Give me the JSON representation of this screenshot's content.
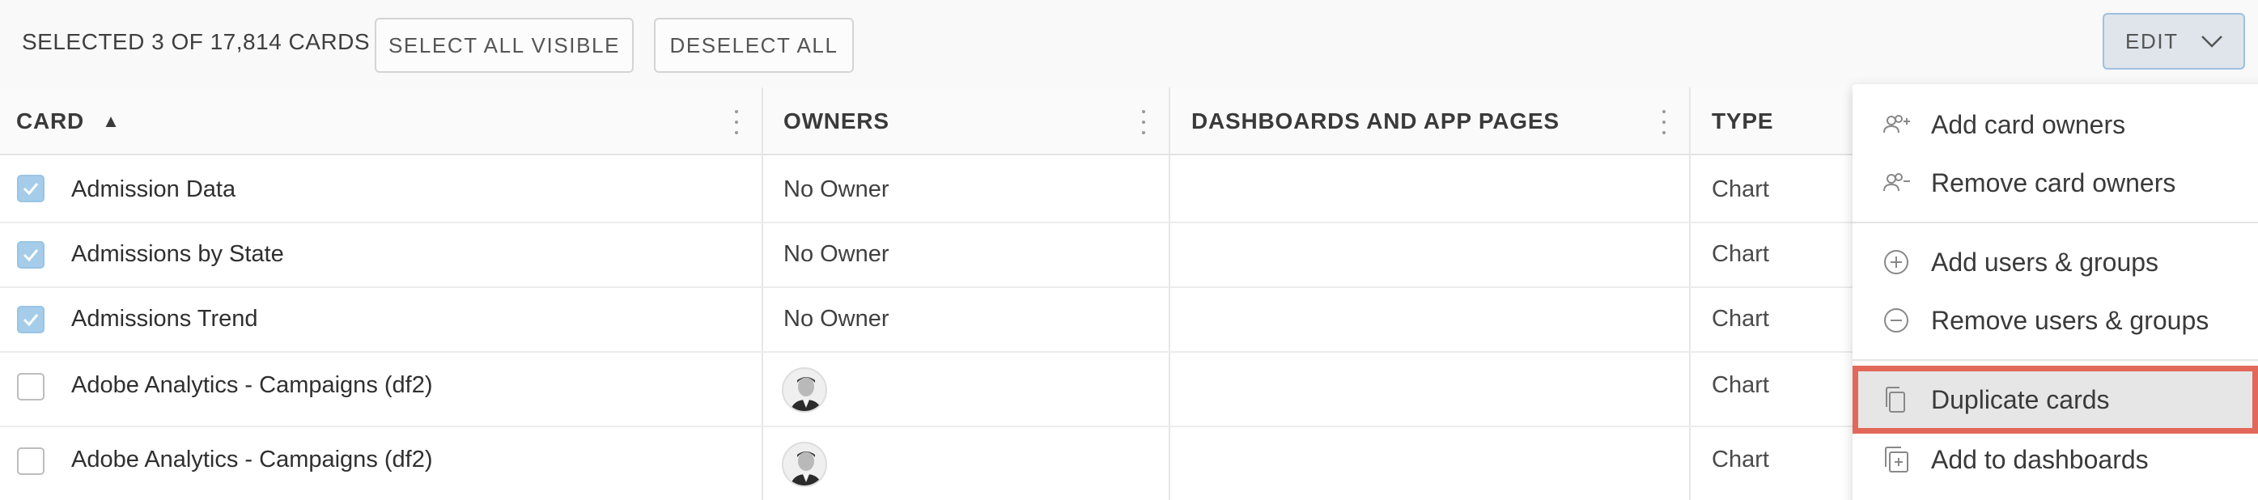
{
  "toolbar": {
    "selected_text": "SELECTED 3 OF 17,814 CARDS",
    "select_all_label": "SELECT ALL VISIBLE",
    "deselect_label": "DESELECT ALL",
    "edit_label": "EDIT"
  },
  "table": {
    "columns": {
      "card": "CARD",
      "sort_indicator": "▲",
      "owners": "OWNERS",
      "dashboards": "DASHBOARDS AND APP PAGES",
      "type": "TYPE"
    },
    "rows": [
      {
        "name": "Admission Data",
        "owner": "No Owner",
        "type": "Chart",
        "checked": true
      },
      {
        "name": "Admissions by State",
        "owner": "No Owner",
        "type": "Chart",
        "checked": true
      },
      {
        "name": "Admissions Trend",
        "owner": "No Owner",
        "type": "Chart",
        "checked": true
      },
      {
        "name": "Adobe Analytics - Campaigns (df2)",
        "owner": "",
        "type": "Chart",
        "checked": false
      },
      {
        "name": "Adobe Analytics - Campaigns (df2)",
        "owner": "",
        "type": "Chart",
        "checked": false
      }
    ]
  },
  "menu": {
    "items": [
      {
        "label": "Add card owners",
        "icon": "add-owners-icon"
      },
      {
        "label": "Remove card owners",
        "icon": "remove-owners-icon"
      },
      {
        "label": "Add users & groups",
        "icon": "plus-circle-icon"
      },
      {
        "label": "Remove users & groups",
        "icon": "minus-circle-icon"
      },
      {
        "label": "Duplicate cards",
        "icon": "duplicate-icon"
      },
      {
        "label": "Add to dashboards",
        "icon": "add-to-dashboard-icon"
      }
    ],
    "highlight_color": "#e26859"
  }
}
